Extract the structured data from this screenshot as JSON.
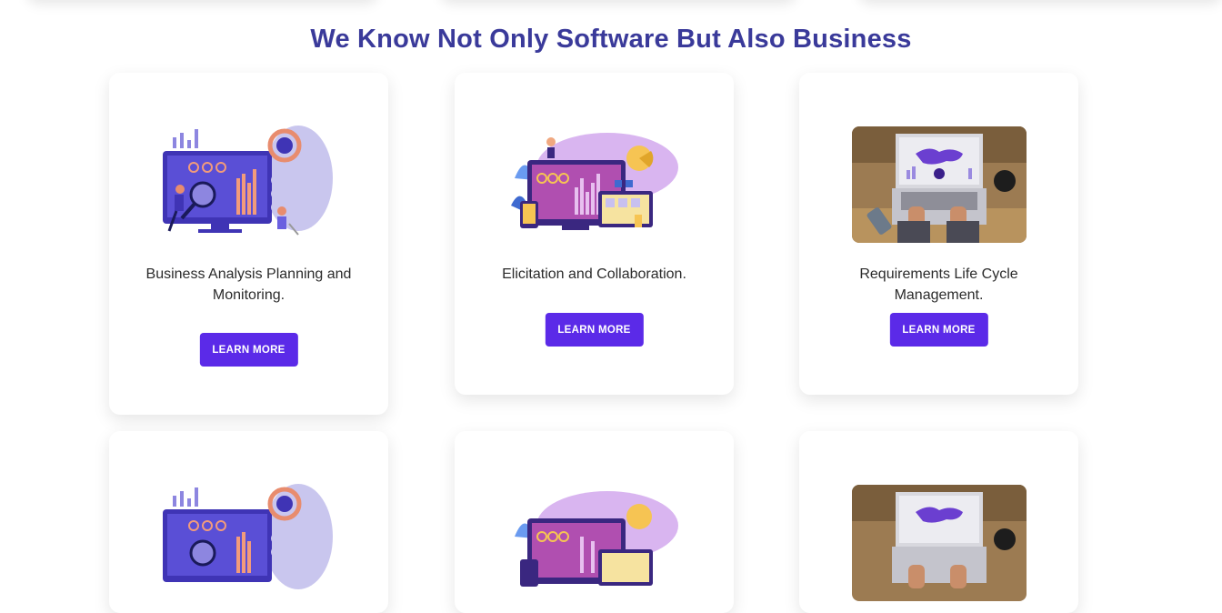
{
  "section": {
    "heading": "We Know Not Only Software But Also Business"
  },
  "cards": [
    {
      "title": "Business Analysis Planning and Monitoring.",
      "button": "LEARN MORE",
      "illustration": "analytics-monitor-illustration"
    },
    {
      "title": "Elicitation and Collaboration.",
      "button": "LEARN MORE",
      "illustration": "collaboration-dashboard-illustration"
    },
    {
      "title": "Requirements Life Cycle Management.",
      "button": "LEARN MORE",
      "illustration": "laptop-world-map-photo"
    },
    {
      "title": "",
      "button": "",
      "illustration": "analytics-monitor-illustration"
    },
    {
      "title": "",
      "button": "",
      "illustration": "collaboration-dashboard-illustration"
    },
    {
      "title": "",
      "button": "",
      "illustration": "laptop-world-map-photo"
    }
  ],
  "colors": {
    "heading": "#3a3a9a",
    "button": "#5b2ae8",
    "card_text": "#2b2b2b"
  }
}
